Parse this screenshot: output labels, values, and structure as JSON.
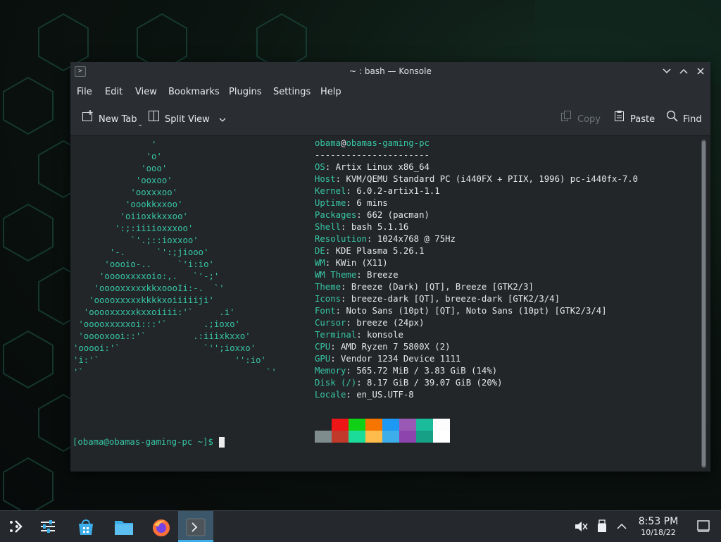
{
  "window": {
    "title": "~ : bash — Konsole",
    "icon": "konsole-icon",
    "controls": [
      "minimize-icon",
      "maximize-icon",
      "close-icon"
    ]
  },
  "menubar": {
    "items": [
      "File",
      "Edit",
      "View",
      "Bookmarks",
      "Plugins",
      "Settings",
      "Help"
    ]
  },
  "toolbar": {
    "new_tab": "New Tab",
    "split_view": "Split View",
    "copy": "Copy",
    "paste": "Paste",
    "find": "Find"
  },
  "terminal": {
    "logo_lines": [
      "               '",
      "              'o'",
      "             'ooo'",
      "            'ooxoo'",
      "           'ooxxxoo'",
      "          'oookkxxoo'",
      "         'oiioxkkxxoo'",
      "        ':;:iiiioxxxoo'",
      "           `'.;::ioxxoo'",
      "       '-.      `':;jiooo'",
      "      'oooio-..     `'i:io'",
      "     'ooooxxxxoio:,.   `'-;'",
      "    'ooooxxxxxkkxoooIi:-.  `'",
      "   'ooooxxxxxkkkkxoiiiiiji'",
      "  'ooooxxxxxkxxoiiii:'`     .i'",
      " 'ooooxxxxxoi:::'`       .;ioxo'",
      " 'ooooxooi::'`         .:iiixkxxo'",
      "'ooooi:'`                `'';ioxxo'",
      "'i:'`                          '':io'",
      "'`                                   `'"
    ],
    "user": "obama",
    "at": "@",
    "host": "obamas-gaming-pc",
    "separator": "----------------------",
    "info": [
      {
        "key": "OS",
        "value": "Artix Linux x86_64"
      },
      {
        "key": "Host",
        "value": "KVM/QEMU Standard PC (i440FX + PIIX, 1996) pc-i440fx-7.0"
      },
      {
        "key": "Kernel",
        "value": "6.0.2-artix1-1.1"
      },
      {
        "key": "Uptime",
        "value": "6 mins"
      },
      {
        "key": "Packages",
        "value": "662 (pacman)"
      },
      {
        "key": "Shell",
        "value": "bash 5.1.16"
      },
      {
        "key": "Resolution",
        "value": "1024x768 @ 75Hz"
      },
      {
        "key": "DE",
        "value": "KDE Plasma 5.26.1"
      },
      {
        "key": "WM",
        "value": "KWin (X11)"
      },
      {
        "key": "WM Theme",
        "value": "Breeze"
      },
      {
        "key": "Theme",
        "value": "Breeze (Dark) [QT], Breeze [GTK2/3]"
      },
      {
        "key": "Icons",
        "value": "breeze-dark [QT], breeze-dark [GTK2/3/4]"
      },
      {
        "key": "Font",
        "value": "Noto Sans (10pt) [QT], Noto Sans (10pt) [GTK2/3/4]"
      },
      {
        "key": "Cursor",
        "value": "breeze (24px)"
      },
      {
        "key": "Terminal",
        "value": "konsole"
      },
      {
        "key": "CPU",
        "value": "AMD Ryzen 7 5800X (2)"
      },
      {
        "key": "GPU",
        "value": "Vendor 1234 Device 1111"
      },
      {
        "key": "Memory",
        "value": "565.72 MiB / 3.83 GiB (14%)"
      },
      {
        "key": "Disk (/)",
        "value": "8.17 GiB / 39.07 GiB (20%)"
      },
      {
        "key": "Locale",
        "value": "en_US.UTF-8"
      }
    ],
    "palette_top": [
      "#232629",
      "#ed1515",
      "#11d116",
      "#f67400",
      "#1d99f3",
      "#9b59b6",
      "#1abc9c",
      "#fcfcfc"
    ],
    "palette_bottom": [
      "#7f8c8d",
      "#c0392b",
      "#1cdc9a",
      "#fdbc4b",
      "#3daee9",
      "#8e44ad",
      "#16a085",
      "#ffffff"
    ],
    "prompt": "[obama@obamas-gaming-pc ~]$"
  },
  "taskbar": {
    "items": [
      {
        "name": "application-launcher-icon"
      },
      {
        "name": "system-settings-icon"
      },
      {
        "name": "discover-store-icon"
      },
      {
        "name": "dolphin-files-icon"
      },
      {
        "name": "firefox-icon"
      },
      {
        "name": "konsole-task-icon"
      }
    ],
    "tray": [
      "volume-muted-icon",
      "removable-device-icon",
      "tray-expand-icon"
    ],
    "clock_time": "8:53 PM",
    "clock_date": "10/18/22",
    "show_desktop": "show-desktop-icon"
  },
  "colors": {
    "accent": "#3daee9",
    "terminal_key": "#36c6a5",
    "terminal_bg": "#232629"
  }
}
